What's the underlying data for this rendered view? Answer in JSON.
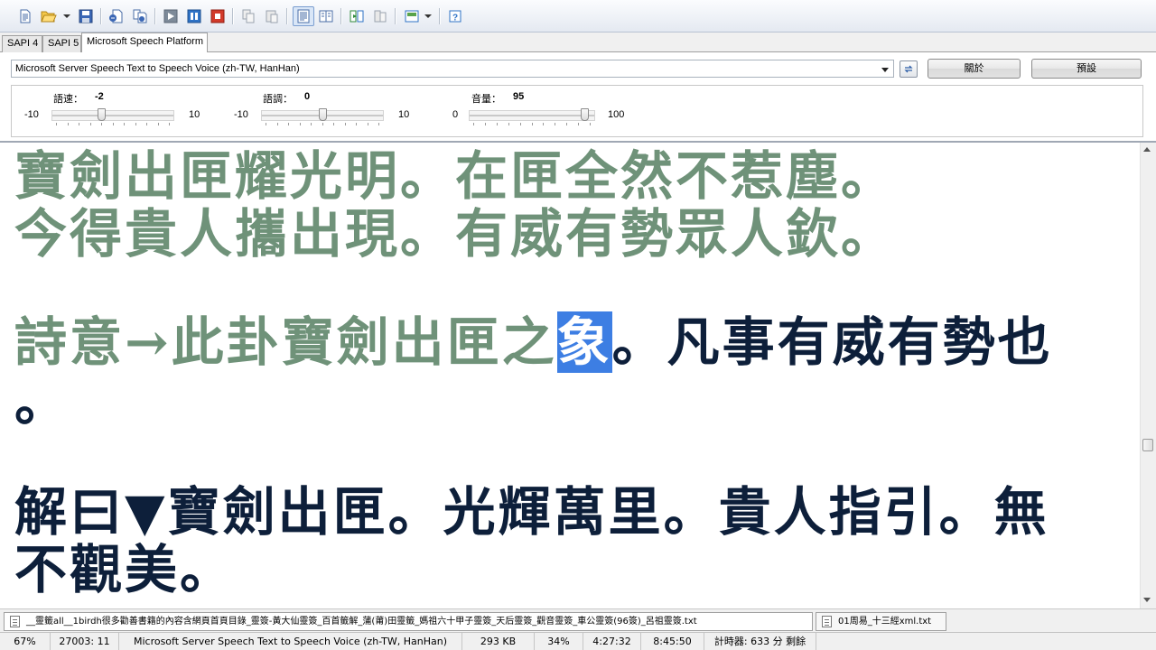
{
  "toolbar": {
    "buttons": [
      {
        "icon": "new-document-icon"
      },
      {
        "icon": "open-folder-icon"
      },
      {
        "icon": "save-icon"
      },
      {
        "icon": "speak-to-file-icon"
      },
      {
        "icon": "batch-convert-icon"
      },
      {
        "icon": "play-icon"
      },
      {
        "icon": "pause-icon"
      },
      {
        "icon": "stop-icon"
      },
      {
        "icon": "copy-icon"
      },
      {
        "icon": "paste-icon"
      },
      {
        "icon": "read-mode-icon"
      },
      {
        "icon": "bookmark-icon"
      },
      {
        "icon": "split-icon"
      },
      {
        "icon": "merge-icon"
      },
      {
        "icon": "options-icon"
      },
      {
        "icon": "help-icon"
      }
    ]
  },
  "tabs": {
    "sapi4": "SAPI 4",
    "sapi5": "SAPI 5",
    "msp": "Microsoft Speech Platform"
  },
  "voice": {
    "selected": "Microsoft Server Speech Text to Speech Voice (zh-TW, HanHan)",
    "about_label": "關於",
    "default_label": "預設"
  },
  "sliders": {
    "rate": {
      "label": "語速：",
      "value": "-2",
      "min": "-10",
      "max": "10",
      "level": -2
    },
    "pitch": {
      "label": "語調：",
      "value": "0",
      "min": "-10",
      "max": "10",
      "level": 0
    },
    "volume": {
      "label": "音量：",
      "value": "95",
      "min": "0",
      "max": "100",
      "level": 95
    }
  },
  "editor": {
    "line1": "寶劍出匣耀光明。在匣全然不惹塵。",
    "line2": "今得貴人攜出現。有威有勢眾人欽。",
    "line3_spoken": "詩意→此卦寶劍出匣之",
    "line3_current": "象",
    "line3_rest": "。凡事有威有勢也",
    "line4": "。",
    "line5": "解曰▼寶劍出匣。光輝萬里。貴人指引。無",
    "line6": "不觀美。"
  },
  "doc_tabs": [
    "__靈籤all__1birdh很多勸善書籍的內容含網頁首頁目錄_靈簽-黃大仙靈簽_百首籤解_蒲(莆)田靈籤_媽祖六十甲子靈簽_天后靈簽_觀音靈簽_車公靈簽(96簽)_呂祖靈簽.txt",
    "01周易_十三經xml.txt"
  ],
  "status": {
    "zoom": "67%",
    "position": "27003: 11",
    "voice": "Microsoft Server Speech Text to Speech Voice (zh-TW, HanHan)",
    "size": "293 KB",
    "progress": "34%",
    "elapsed": "4:27:32",
    "total": "8:45:50",
    "timer": "計時器: 633 分 剩餘"
  }
}
